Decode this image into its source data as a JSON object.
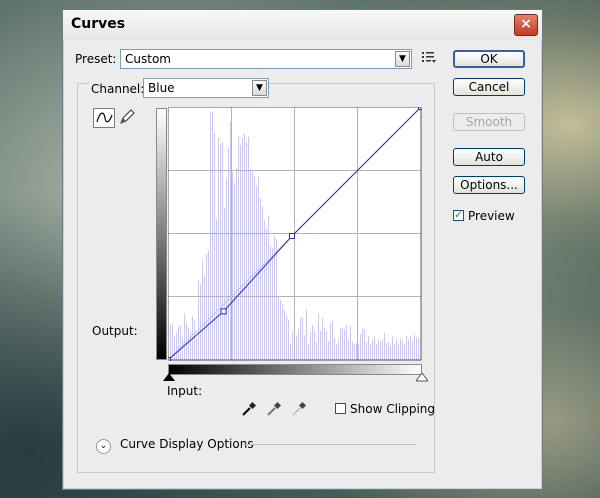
{
  "dialog": {
    "title": "Curves",
    "close_label": "×"
  },
  "preset": {
    "label": "Preset:",
    "value": "Custom"
  },
  "channel": {
    "label": "Channel:",
    "value": "Blue"
  },
  "buttons": {
    "ok": "OK",
    "cancel": "Cancel",
    "smooth": "Smooth",
    "auto": "Auto",
    "options": "Options..."
  },
  "preview": {
    "label": "Preview",
    "checked": true
  },
  "labels": {
    "output": "Output:",
    "input": "Input:",
    "show_clipping": "Show Clipping",
    "curve_display_options": "Curve Display Options"
  },
  "show_clipping": {
    "checked": false
  },
  "curve": {
    "channel_color": "#2a2ab8",
    "histogram_color": "#c8c8f0",
    "points": [
      [
        0,
        0
      ],
      [
        56,
        49
      ],
      [
        125,
        125
      ],
      [
        255,
        255
      ]
    ]
  },
  "icons": {
    "curve_tool": "curve-tool-icon",
    "pencil_tool": "pencil-tool-icon",
    "black_point": "black-eyedropper-icon",
    "gray_point": "gray-eyedropper-icon",
    "white_point": "white-eyedropper-icon",
    "preset_menu": "preset-options-menu-icon",
    "expander": "chevron-down-icon"
  }
}
